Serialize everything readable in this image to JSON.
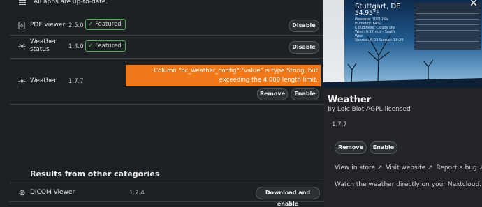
{
  "list": {
    "status": "All apps are up-to-date.",
    "apps": [
      {
        "name": "PDF viewer",
        "version": "2.5.0",
        "badge": "Featured",
        "action": "Disable"
      },
      {
        "name": "Weather status",
        "version": "1.4.0",
        "badge": "Featured",
        "action": "Disable"
      },
      {
        "name": "Weather",
        "version": "1.7.7",
        "error": "Column \"oc_weather_config\".\"value\" is type String, but exceeding the 4.000 length limit.",
        "actions": [
          "Remove",
          "Enable"
        ]
      }
    ],
    "other_section": "Results from other categories",
    "other_apps": [
      {
        "name": "DICOM Viewer",
        "version": "1.2.4",
        "action": "Download and enable"
      }
    ]
  },
  "detail": {
    "screenshot": {
      "city": "Stuttgart, DE",
      "temp": "54.95°F",
      "lines": [
        "Pressure: 1021 hPa",
        "Humidity: 64%",
        "Cloudiness: Cloudy sky",
        "Wind: 9.17 m/s - South West",
        "Sunrise: 6:03 Sunset: 18:29"
      ]
    },
    "close_glyph": "✕",
    "title": "Weather",
    "author": "by Loic Blot AGPL-licensed",
    "version": "1.7.7",
    "buttons": {
      "remove": "Remove",
      "enable": "Enable"
    },
    "links": [
      "View in store ↗",
      "Visit website ↗",
      "Report a bug ↗"
    ],
    "description": "Watch the weather directly on your Nextcloud."
  },
  "colors": {
    "error_bg": "#f07818",
    "featured_border": "#4caf50"
  },
  "icons": [
    "menu-icon",
    "pdf-icon",
    "sun-icon",
    "gear-icon",
    "check-icon",
    "close-icon"
  ]
}
